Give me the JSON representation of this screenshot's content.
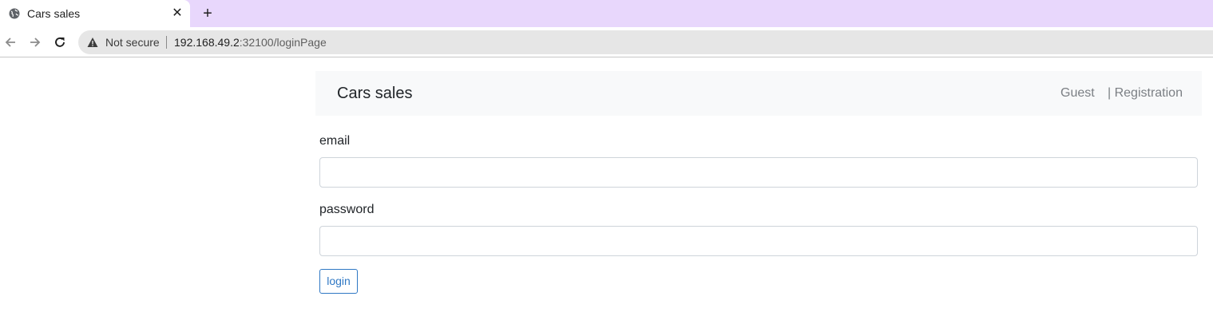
{
  "browser": {
    "tab_title": "Cars sales",
    "close_glyph": "✕",
    "new_tab_glyph": "+",
    "security_label": "Not secure",
    "url_host": "192.168.49.2",
    "url_rest": ":32100/loginPage"
  },
  "navbar": {
    "brand": "Cars sales",
    "guest": "Guest",
    "registration": "| Registration"
  },
  "form": {
    "email_label": "email",
    "email_value": "",
    "password_label": "password",
    "password_value": "",
    "login_label": "login"
  },
  "colors": {
    "tabstrip": "#e8d7fc",
    "navbar_bg": "#f8f9fa",
    "login_accent": "#2f78c4"
  }
}
